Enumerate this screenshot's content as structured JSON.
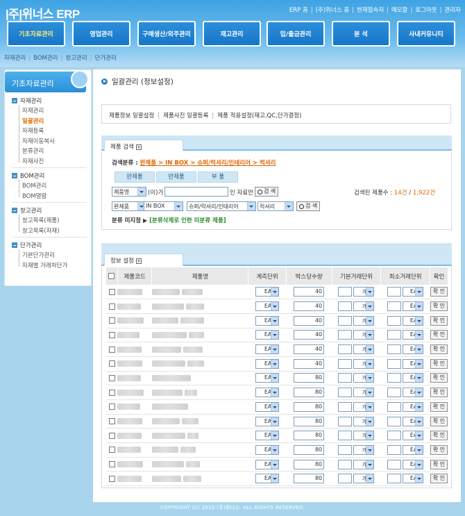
{
  "header": {
    "logo": "|주|위너스 ERP",
    "top_links": [
      "ERP 홈",
      "(주)위너스 홈",
      "현재접속자",
      "메모함",
      "로그아웃",
      "관리자"
    ]
  },
  "gnb": [
    {
      "label": "기초자료관리",
      "active": true
    },
    {
      "label": "영업관리",
      "active": false
    },
    {
      "label": "구매생산/외주관리",
      "active": false
    },
    {
      "label": "재고관리",
      "active": false
    },
    {
      "label": "입/출금관리",
      "active": false
    },
    {
      "label": "분 석",
      "active": false
    },
    {
      "label": "사내커뮤니티",
      "active": false
    }
  ],
  "subnav": [
    "자재관리",
    "BOM관리",
    "창고관리",
    "단가관리"
  ],
  "sidebar": {
    "title": "기초자료관리",
    "categories": [
      {
        "label": "자재관리",
        "items": [
          "자재관리",
          "일괄관리",
          "자재등록",
          "자재이동복사",
          "분류관리",
          "자재사진"
        ],
        "selected": 1
      },
      {
        "label": "BOM관리",
        "items": [
          "BOM관리",
          "BOM열람"
        ]
      },
      {
        "label": "창고관리",
        "items": [
          "창고목록(제품)",
          "창고목록(자재)"
        ]
      },
      {
        "label": "단가관리",
        "items": [
          "기본단가관리",
          "자재별 거래처단가"
        ]
      }
    ]
  },
  "page": {
    "title": "일괄관리 (정보설정)",
    "links": [
      "제품정보 일괄설정",
      "제품사진 일괄등록",
      "제품 적용설정(재고,QC,단가결정)"
    ]
  },
  "search": {
    "tab_label": "제품 검색",
    "crumb_label": "검색분류 :",
    "crumb_path": "완제품 > IN BOX > 슈퍼/럭셔리/인테리어 > 럭셔리",
    "filter_buttons": [
      "완제품",
      "반제품",
      "부 품"
    ],
    "field_select": "제품명",
    "field_suffix": "(이)가",
    "field_value": "",
    "field_tail": "인 자료만",
    "search_btn": "검 색",
    "result_label": "검색된 제품수 :",
    "result_count": "14건",
    "result_sep": "/",
    "result_total": "1,922건",
    "category_selects": [
      "완제품",
      "IN BOX",
      "슈퍼/럭셔리/인테리어",
      "럭셔리"
    ],
    "search_btn2": "검 색",
    "unclassified_label": "분류 미지정",
    "unclassified_link": "[분류삭제로 인한 미분류 제품]"
  },
  "table": {
    "tab_label": "정보 설정",
    "headers": [
      "제품코드",
      "제품명",
      "계측단위",
      "박스당수량",
      "기본거래단위",
      "최소거래단위",
      "확인"
    ],
    "rows": [
      {
        "unit": "EA",
        "box_qty": "40",
        "base_unit": "개",
        "min_unit": "EA",
        "confirm": "확 인"
      },
      {
        "unit": "EA",
        "box_qty": "40",
        "base_unit": "개",
        "min_unit": "EA",
        "confirm": "확 인"
      },
      {
        "unit": "EA",
        "box_qty": "40",
        "base_unit": "개",
        "min_unit": "EA",
        "confirm": "확 인"
      },
      {
        "unit": "EA",
        "box_qty": "40",
        "base_unit": "개",
        "min_unit": "EA",
        "confirm": "확 인"
      },
      {
        "unit": "EA",
        "box_qty": "40",
        "base_unit": "개",
        "min_unit": "EA",
        "confirm": "확 인"
      },
      {
        "unit": "EA",
        "box_qty": "40",
        "base_unit": "개",
        "min_unit": "EA",
        "confirm": "확 인"
      },
      {
        "unit": "EA",
        "box_qty": "80",
        "base_unit": "개",
        "min_unit": "EA",
        "confirm": "확 인"
      },
      {
        "unit": "EA",
        "box_qty": "80",
        "base_unit": "개",
        "min_unit": "EA",
        "confirm": "확 인"
      },
      {
        "unit": "EA",
        "box_qty": "80",
        "base_unit": "개",
        "min_unit": "EA",
        "confirm": "확 인"
      },
      {
        "unit": "EA",
        "box_qty": "80",
        "base_unit": "개",
        "min_unit": "EA",
        "confirm": "확 인"
      },
      {
        "unit": "EA",
        "box_qty": "80",
        "base_unit": "개",
        "min_unit": "EA",
        "confirm": "확 인"
      },
      {
        "unit": "EA",
        "box_qty": "80",
        "base_unit": "개",
        "min_unit": "EA",
        "confirm": "확 인"
      },
      {
        "unit": "EA",
        "box_qty": "80",
        "base_unit": "개",
        "min_unit": "EA",
        "confirm": "확 인"
      },
      {
        "unit": "EA",
        "box_qty": "80",
        "base_unit": "개",
        "min_unit": "EA",
        "confirm": "확 인"
      }
    ]
  },
  "footer": "COPYRIGHT (C) 2010 (주)위너스. ALL RIGHTS RESERVED."
}
